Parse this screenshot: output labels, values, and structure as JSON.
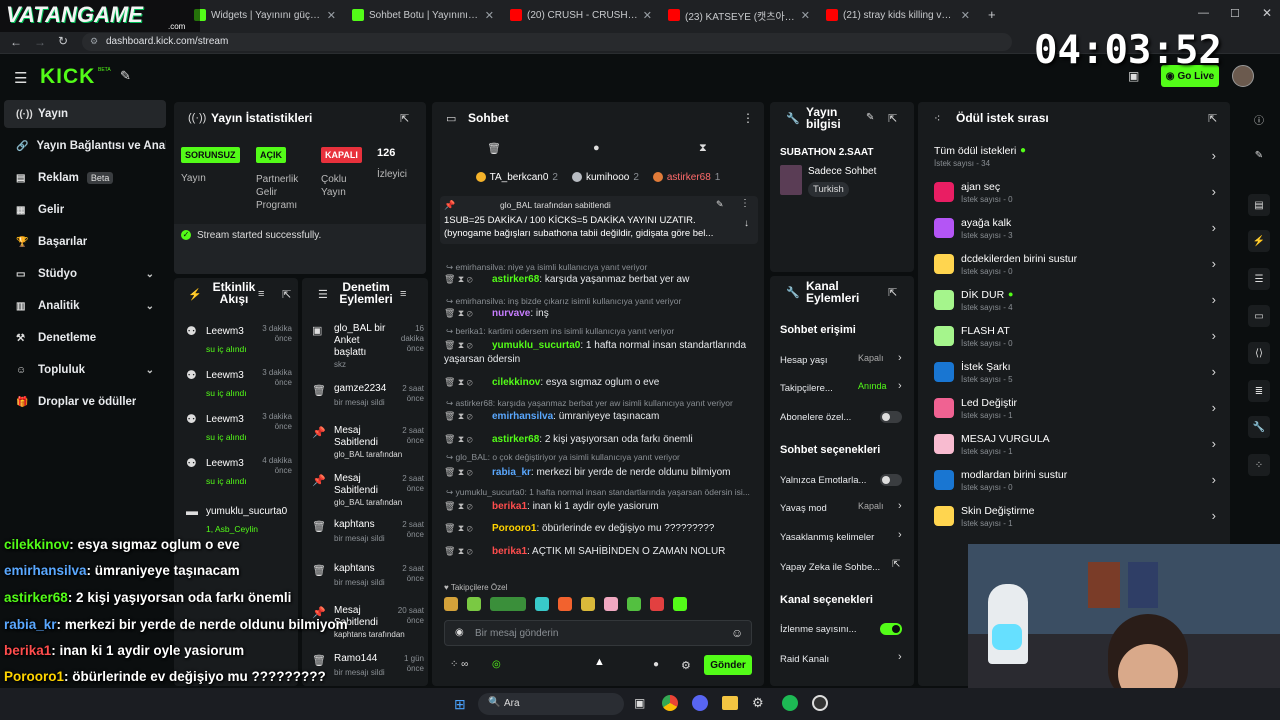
{
  "browser": {
    "tabs": [
      {
        "label": "VATANGAME",
        "color": "#1565c0"
      },
      {
        "label": "Widgets | Yayınını güçlendirmek",
        "color": "#53fc18"
      },
      {
        "label": "Sohbet Botu | Yayınını güçlendir",
        "color": "#53fc18"
      },
      {
        "label": "(20) CRUSH - CRUSH! | Gözü Ka",
        "color": "#ff0000"
      },
      {
        "label": "(23) KATSEYE (캣츠아이) 'Hoot",
        "color": "#ff0000"
      },
      {
        "label": "(21) stray kids killing voice - You",
        "color": "#ff0000"
      }
    ],
    "new_tab": "+",
    "url": "dashboard.kick.com/stream"
  },
  "overlay": {
    "brand": "VATANGAME",
    "brand_sub": ".com",
    "clock": "04:03:52",
    "chat": [
      {
        "user": "cilekkinov",
        "msg": ": esya sıgmaz oglum o eve",
        "color": "#53fc18"
      },
      {
        "user": "emirhansilva",
        "msg": ": ümraniyeye taşınacam",
        "color": "#5aa8ff"
      },
      {
        "user": "astirker68",
        "msg": ": 2 kişi yaşıyorsan oda farkı önemli",
        "color": "#53fc18"
      },
      {
        "user": "rabia_kr",
        "msg": ": merkezi bir yerde de nerde oldunu bilmiyom",
        "color": "#5aa8ff"
      },
      {
        "user": "berika1",
        "msg": ": inan ki 1 aydir oyle yasiorum",
        "color": "#ff4d4d"
      },
      {
        "user": "Poroorо1",
        "msg": ": öbürlerinde ev değişiyo mu ?????????",
        "color": "#ffd400"
      },
      {
        "user": "berika1",
        "msg": ": AÇTIK MI SAHİBİNDEN O ZAMAN NOLUR",
        "color": "#ff4d4d"
      }
    ]
  },
  "topbar": {
    "logo": "KICK",
    "logo_sup": "BETA",
    "go_live": "Go Live"
  },
  "sidebar": {
    "items": [
      {
        "label": "Yayın",
        "icon": "signal-icon",
        "active": true
      },
      {
        "label": "Yayın Bağlantısı ve Anahtar",
        "icon": "link-icon"
      },
      {
        "label": "Reklam",
        "icon": "ad-icon",
        "badge": "Beta"
      },
      {
        "label": "Gelir",
        "icon": "wallet-icon"
      },
      {
        "label": "Başarılar",
        "icon": "trophy-icon"
      },
      {
        "label": "Stüdyo",
        "icon": "studio-icon",
        "chevron": true
      },
      {
        "label": "Analitik",
        "icon": "chart-icon",
        "chevron": true
      },
      {
        "label": "Denetleme",
        "icon": "gavel-icon"
      },
      {
        "label": "Topluluk",
        "icon": "community-icon",
        "chevron": true
      },
      {
        "label": "Droplar ve ödüller",
        "icon": "gift-icon"
      }
    ]
  },
  "stats": {
    "title": "Yayın İstatistikleri",
    "stream_tag": "SORUNSUZ",
    "stream_label": "Yayın",
    "partner_tag": "AÇIK",
    "partner_label": "Partnerlik Gelir Programı",
    "multi_tag": "KAPALI",
    "multi_label": "Çoklu Yayın",
    "viewers": "126",
    "viewers_label": "İzleyici",
    "success": "Stream started successfully."
  },
  "activity": {
    "title": "Etkinlik Akışı",
    "items": [
      {
        "user": "Leewm3",
        "action": "su iç alındı",
        "time": "3 dakika önce"
      },
      {
        "user": "Leewm3",
        "action": "su iç alındı",
        "time": "3 dakika önce"
      },
      {
        "user": "Leewm3",
        "action": "su iç alındı",
        "time": "3 dakika önce"
      },
      {
        "user": "Leewm3",
        "action": "su iç alındı",
        "time": "4 dakika önce"
      },
      {
        "user": "yumuklu_sucurta0",
        "action": "1, Asb_Ceylin",
        "time": ""
      }
    ]
  },
  "moderation": {
    "title": "Denetim Eylemleri",
    "items": [
      {
        "name": "glo_BAL bir Anket başlattı",
        "sub": "skz",
        "time": "16 dakika önce"
      },
      {
        "name": "gamze2234",
        "sub": "bir mesajı sildi",
        "time": "2 saat önce"
      },
      {
        "name": "Mesaj Sabitlendi",
        "sub": "glo_BAL tarafından",
        "time": "2 saat önce"
      },
      {
        "name": "Mesaj Sabitlendi",
        "sub": "glo_BAL tarafından",
        "time": "2 saat önce"
      },
      {
        "name": "kaphtans",
        "sub": "bir mesajı sildi",
        "time": "2 saat önce"
      },
      {
        "name": "kaphtans",
        "sub": "bir mesajı sildi",
        "time": "2 saat önce"
      },
      {
        "name": "Mesaj Sabitlendi",
        "sub": "kaphtans tarafından",
        "time": "20 saat önce"
      },
      {
        "name": "Ramo144",
        "sub": "bir mesajı sildi",
        "time": "1 gün önce"
      }
    ]
  },
  "chat": {
    "title": "Sohbet",
    "leaders": [
      {
        "user": "TA_berkcan0",
        "count": "2"
      },
      {
        "user": "kumihooo",
        "count": "2"
      },
      {
        "user": "astirker68",
        "count": "1"
      }
    ],
    "pinned_by": "glo_BAL tarafından sabitlendi",
    "pinned_text": "1SUB=25 DAKİKA / 100 KİCKS=5 DAKİKA YAYINI UZATIR. (bynogame bağışları subathona tabii değildir, gidişata göre bel...",
    "messages": [
      {
        "reply": "emirhansilva: niye ya isimli kullanıcıya yanıt veriyor",
        "user": "astirker68",
        "text": ": karşıda yaşanmaz berbat yer aw",
        "color": "#53fc18"
      },
      {
        "reply": "emirhansilva: inş bizde çıkarız isimli kullanıcıya yanıt veriyor",
        "user": "nurvave",
        "text": ": inş",
        "color": "#c77dff"
      },
      {
        "reply": "berika1: kartimi odersem ins isimli kullanıcıya yanıt veriyor",
        "user": "yumuklu_sucurta0",
        "text": ": 1 hafta normal insan standartlarında yaşarsan ödersin",
        "color": "#53fc18"
      },
      {
        "reply": "",
        "user": "cilekkinov",
        "text": ": esya sıgmaz oglum o eve",
        "color": "#53fc18"
      },
      {
        "reply": "astirker68: karşıda yaşanmaz berbat yer aw isimli kullanıcıya yanıt veriyor",
        "user": "emirhansilva",
        "text": ": ümraniyeye taşınacam",
        "color": "#5aa8ff"
      },
      {
        "reply": "",
        "user": "astirker68",
        "text": ": 2 kişi yaşıyorsan oda farkı önemli",
        "color": "#53fc18"
      },
      {
        "reply": "glo_BAL: o çok değiştiriyor ya isimli kullanıcıya yanıt veriyor",
        "user": "rabia_kr",
        "text": ": merkezi bir yerde de nerde oldunu bilmiyom",
        "color": "#5aa8ff"
      },
      {
        "reply": "yumuklu_sucurta0: 1 hafta normal insan standartlarında yaşarsan ödersin isi...",
        "user": "berika1",
        "text": ": inan ki 1 aydir oyle yasiorum",
        "color": "#ff4d4d"
      },
      {
        "reply": "",
        "user": "Poroorо1",
        "text": ": öbürlerinde ev değişiyo mu ?????????",
        "color": "#ffd400"
      },
      {
        "reply": "",
        "user": "berika1",
        "text": ": AÇTIK MI SAHİBİNDEN O ZAMAN NOLUR",
        "color": "#ff4d4d"
      }
    ],
    "emote_label": "Takipçilere Özel",
    "input_placeholder": "Bir mesaj gönderin",
    "send": "Gönder"
  },
  "stream_info": {
    "title": "Yayın bilgisi",
    "stream_title": "SUBATHON 2.SAAT",
    "category": "Sadece Sohbet",
    "language": "Turkish"
  },
  "channel_actions": {
    "title": "Kanal Eylemleri",
    "chat_access": "Sohbet erişimi",
    "rows1": [
      {
        "label": "Hesap yaşı",
        "value": "Kapalı"
      },
      {
        "label": "Takipçilere...",
        "value": "Anında"
      },
      {
        "label": "Abonelere özel...",
        "value": ""
      }
    ],
    "chat_options": "Sohbet seçenekleri",
    "rows2": [
      {
        "label": "Yalnızca Emotlarla...",
        "value": ""
      },
      {
        "label": "Yavaş mod",
        "value": "Kapalı"
      },
      {
        "label": "Yasaklanmış kelimeler",
        "value": ""
      },
      {
        "label": "Yapay Zeka ile Sohbe...",
        "value": ""
      }
    ],
    "channel_options": "Kanal seçenekleri",
    "rows3": [
      {
        "label": "İzlenme sayısını...",
        "value": ""
      },
      {
        "label": "Raid Kanalı",
        "value": ""
      }
    ]
  },
  "rewards": {
    "title": "Ödül istek sırası",
    "all_label": "Tüm ödül istekleri",
    "all_count": "İstek sayısı - 34",
    "items": [
      {
        "name": "ajan seç",
        "count": "İstek sayısı - 0",
        "color": "#e91e63"
      },
      {
        "name": "ayağa kalk",
        "count": "İstek sayısı - 3",
        "color": "#b455f5"
      },
      {
        "name": "dcdekilerden birini sustur",
        "count": "İstek sayısı - 0",
        "color": "#ffd54f"
      },
      {
        "name": "DİK DUR",
        "count": "İstek sayısı - 4",
        "color": "#a5f58c"
      },
      {
        "name": "FLASH AT",
        "count": "İstek sayısı - 0",
        "color": "#a5f58c"
      },
      {
        "name": "İstek Şarkı",
        "count": "İstek sayısı - 5",
        "color": "#1976d2"
      },
      {
        "name": "Led Değiştir",
        "count": "İstek sayısı - 1",
        "color": "#f06292"
      },
      {
        "name": "MESAJ VURGULA",
        "count": "İstek sayısı - 1",
        "color": "#f8bbd0"
      },
      {
        "name": "modlardan birini sustur",
        "count": "İstek sayısı - 0",
        "color": "#1976d2"
      },
      {
        "name": "Skin Değiştirme",
        "count": "İstek sayısı - 1",
        "color": "#ffd54f"
      }
    ]
  },
  "taskbar": {
    "search": "Ara"
  }
}
